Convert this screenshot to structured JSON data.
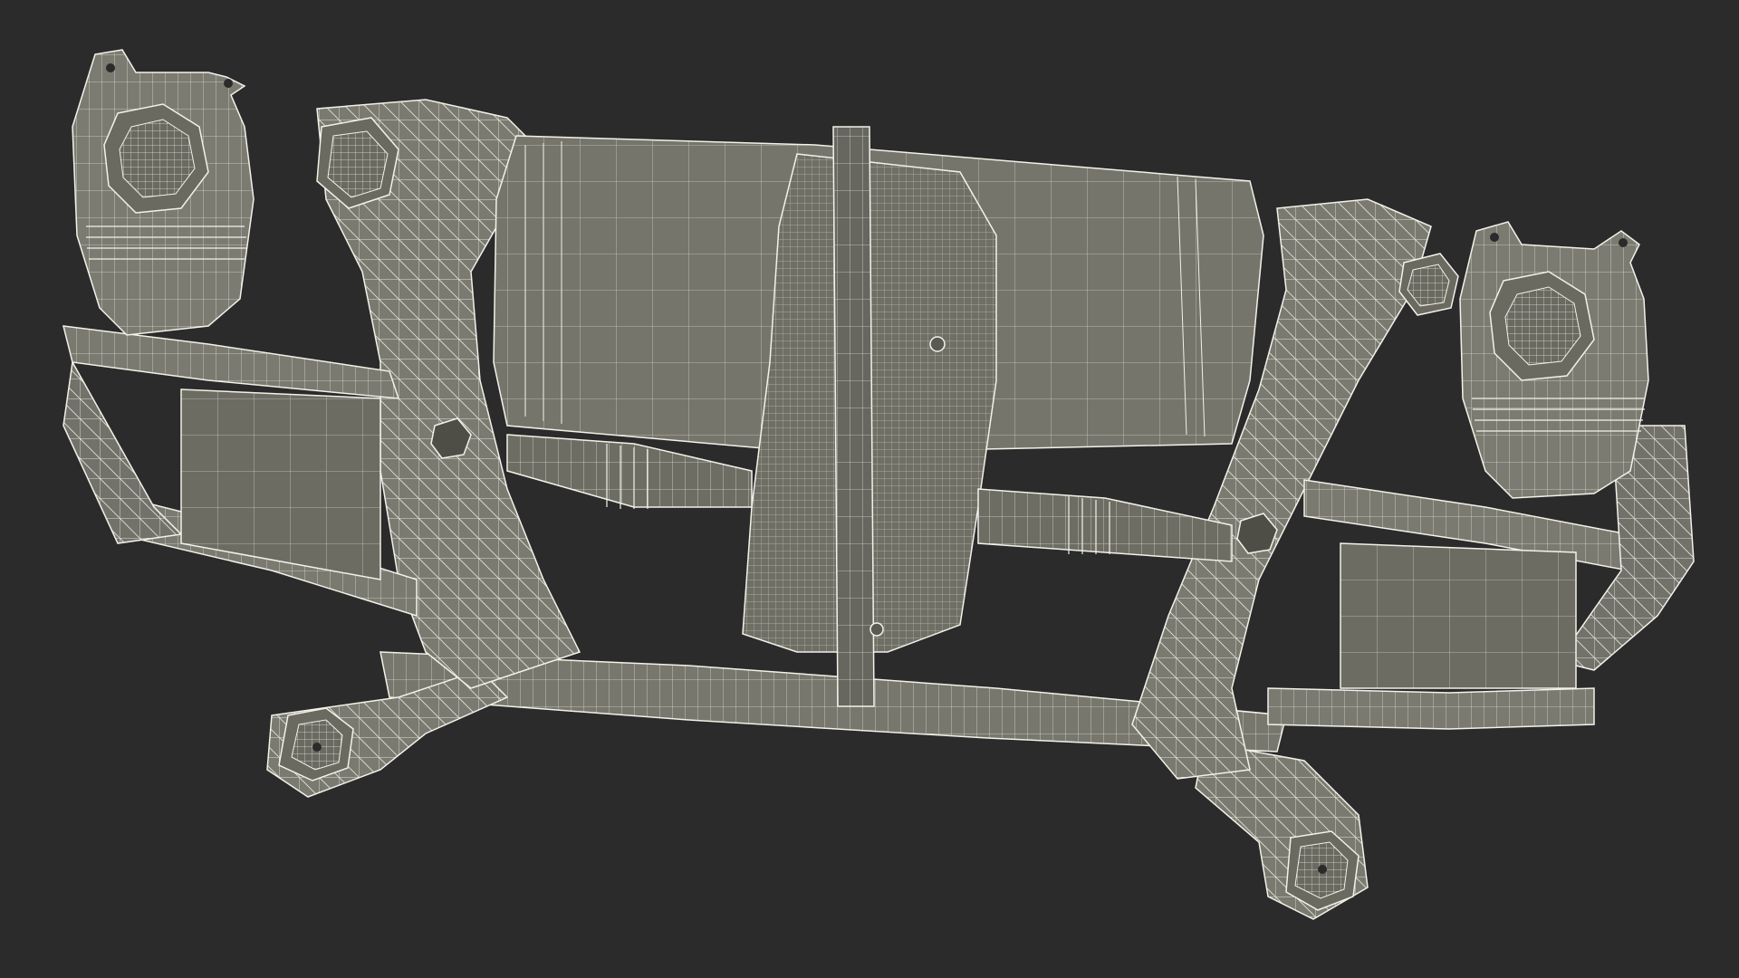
{
  "scene": {
    "background_color": "#2b2b2b",
    "surface_color": "#7a7a70",
    "surface_dark_color": "#5f5f57",
    "wire_color": "#f2f2ea",
    "subject": "rear-subframe-drive-unit-wireframe-render"
  }
}
